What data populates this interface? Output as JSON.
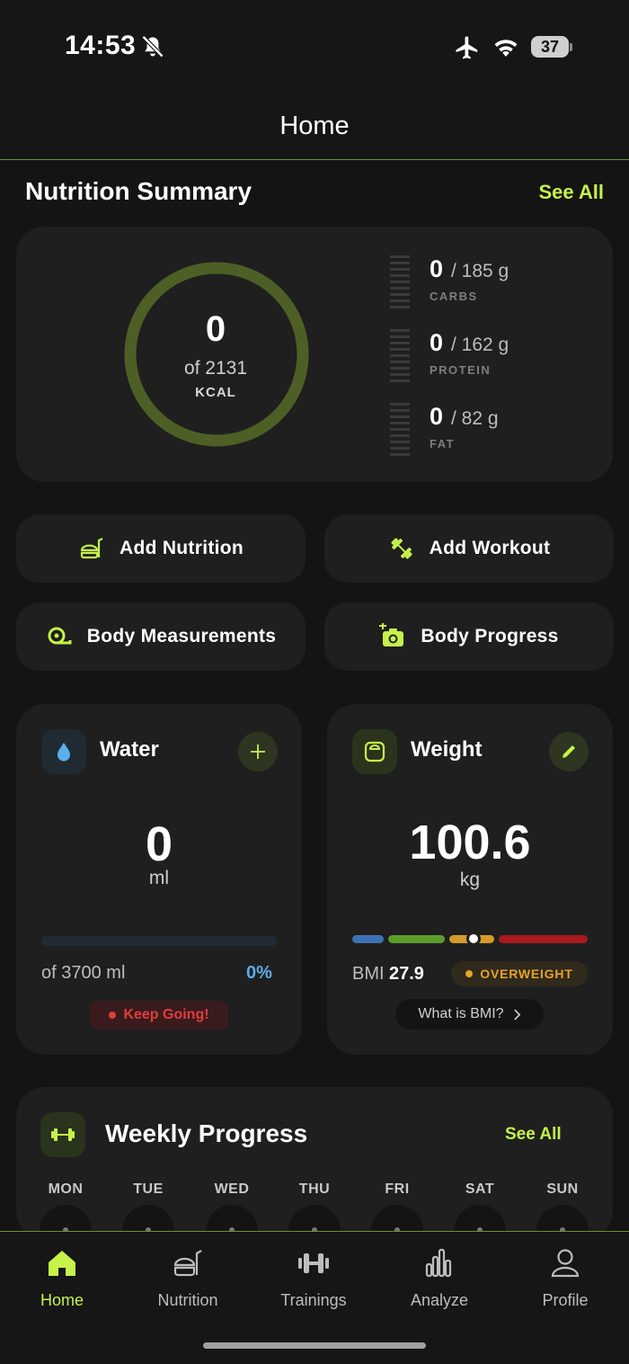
{
  "status_bar": {
    "time": "14:53",
    "battery": "37"
  },
  "header": {
    "title": "Home"
  },
  "nutrition_summary": {
    "title": "Nutrition Summary",
    "see_all": "See All",
    "kcal_value": "0",
    "kcal_of": "of 2131",
    "kcal_unit": "KCAL",
    "macros": [
      {
        "value": "0",
        "goal": "/ 185 g",
        "label": "CARBS"
      },
      {
        "value": "0",
        "goal": "/ 162 g",
        "label": "PROTEIN"
      },
      {
        "value": "0",
        "goal": "/ 82 g",
        "label": "FAT"
      }
    ]
  },
  "actions": [
    {
      "label": "Add Nutrition",
      "icon": "food-icon"
    },
    {
      "label": "Add Workout",
      "icon": "dumbbell-icon"
    },
    {
      "label": "Body Measurements",
      "icon": "tape-measure-icon"
    },
    {
      "label": "Body Progress",
      "icon": "camera-add-icon"
    }
  ],
  "water": {
    "title": "Water",
    "value": "0",
    "unit": "ml",
    "of": "of 3700 ml",
    "percent": "0%",
    "progress_fraction": 0,
    "status": "Keep Going!"
  },
  "weight": {
    "title": "Weight",
    "value": "100.6",
    "unit": "kg",
    "bmi_label": "BMI",
    "bmi_value": "27.9",
    "bmi_category": "OVERWEIGHT",
    "bmi_help": "What is BMI?"
  },
  "weekly_progress": {
    "title": "Weekly Progress",
    "see_all": "See All",
    "days": [
      "MON",
      "TUE",
      "WED",
      "THU",
      "FRI",
      "SAT",
      "SUN"
    ]
  },
  "tabs": [
    {
      "label": "Home",
      "icon": "home-icon",
      "active": true
    },
    {
      "label": "Nutrition",
      "icon": "food-icon",
      "active": false
    },
    {
      "label": "Trainings",
      "icon": "dumbbell-icon",
      "active": false
    },
    {
      "label": "Analyze",
      "icon": "bar-chart-icon",
      "active": false
    },
    {
      "label": "Profile",
      "icon": "user-icon",
      "active": false
    }
  ],
  "colors": {
    "accent": "#c6f24a",
    "ring": "#4e5f25",
    "water": "#5aaee9",
    "warning": "#e8a22b",
    "danger": "#e23d3d"
  }
}
